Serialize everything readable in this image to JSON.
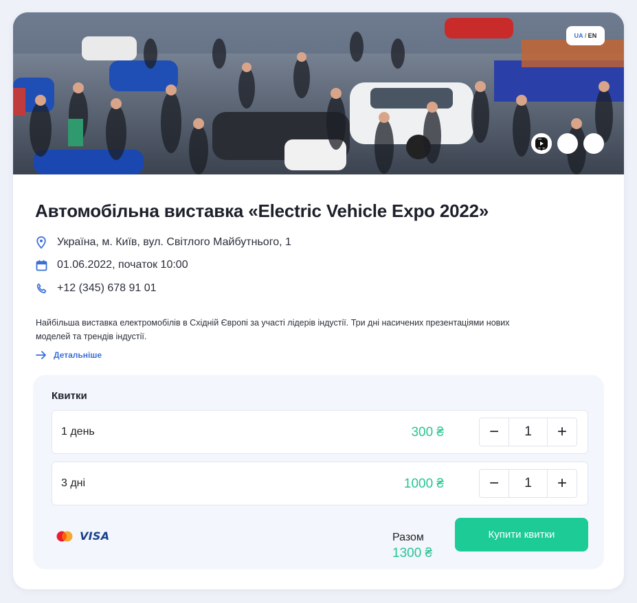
{
  "language": {
    "active": "UA",
    "separator": "/",
    "other": "EN"
  },
  "social": [
    "facebook-icon",
    "instagram-icon",
    "youtube-icon"
  ],
  "event": {
    "title": "Автомобільна виставка «Electric Vehicle Expo 2022»",
    "address": "Україна, м. Київ, вул. Світлого Майбутнього, 1",
    "date": "01.06.2022, початок 10:00",
    "phone": "+12 (345) 678 91 01",
    "description": "Найбільша виставка електромобілів в Східній Європі за участі лідерів індустії. Три дні насичених презентаціями нових моделей та трендів індустії.",
    "more_label": "Детальніше"
  },
  "tickets": {
    "title": "Квитки",
    "items": [
      {
        "name": "1 день",
        "price": "300 ₴",
        "qty": "1",
        "minus": "−",
        "plus": "+"
      },
      {
        "name": "3 дні",
        "price": "1000 ₴",
        "qty": "1",
        "minus": "−",
        "plus": "+"
      }
    ],
    "payment": {
      "visa": "VISA"
    },
    "total_label": "Разом",
    "total_value": "1300 ₴",
    "buy_label": "Купити квитки"
  },
  "colors": {
    "accent": "#1ccb96",
    "price": "#27c593",
    "link": "#3a6fd8"
  }
}
